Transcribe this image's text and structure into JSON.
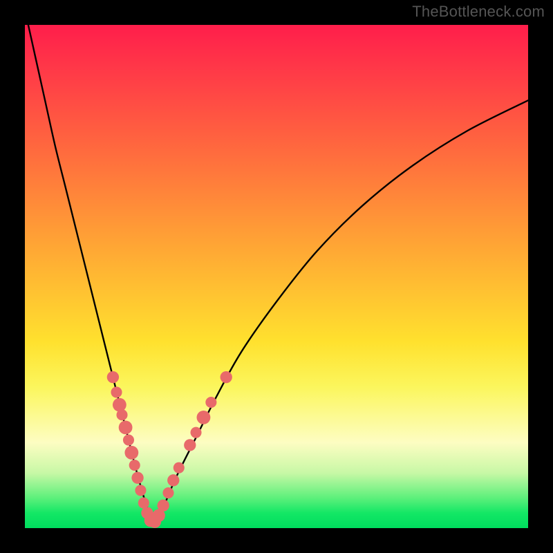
{
  "watermark": "TheBottleneck.com",
  "chart_data": {
    "type": "line",
    "title": "",
    "xlabel": "",
    "ylabel": "",
    "xlim": [
      0,
      100
    ],
    "ylim": [
      0,
      100
    ],
    "series": [
      {
        "name": "bottleneck-curve",
        "x": [
          0,
          2,
          4,
          6,
          8,
          10,
          12,
          14,
          16,
          18,
          20,
          22,
          24,
          25.5,
          27,
          30,
          34,
          38,
          43,
          50,
          58,
          67,
          77,
          88,
          100
        ],
        "values": [
          103,
          94,
          85,
          76,
          68,
          60,
          52,
          44,
          36,
          28,
          20,
          12,
          5,
          1,
          3,
          10,
          18,
          26,
          35,
          45,
          55,
          64,
          72,
          79,
          85
        ]
      }
    ],
    "markers": {
      "name": "data-points",
      "items": [
        {
          "x": 17.5,
          "y": 30.0,
          "r": 1.4
        },
        {
          "x": 18.2,
          "y": 27.0,
          "r": 1.3
        },
        {
          "x": 18.8,
          "y": 24.5,
          "r": 1.6
        },
        {
          "x": 19.3,
          "y": 22.5,
          "r": 1.3
        },
        {
          "x": 20.0,
          "y": 20.0,
          "r": 1.6
        },
        {
          "x": 20.6,
          "y": 17.5,
          "r": 1.3
        },
        {
          "x": 21.2,
          "y": 15.0,
          "r": 1.6
        },
        {
          "x": 21.8,
          "y": 12.5,
          "r": 1.3
        },
        {
          "x": 22.4,
          "y": 10.0,
          "r": 1.4
        },
        {
          "x": 23.0,
          "y": 7.5,
          "r": 1.3
        },
        {
          "x": 23.6,
          "y": 5.0,
          "r": 1.3
        },
        {
          "x": 24.3,
          "y": 3.0,
          "r": 1.4
        },
        {
          "x": 25.0,
          "y": 1.5,
          "r": 1.5
        },
        {
          "x": 25.8,
          "y": 1.3,
          "r": 1.5
        },
        {
          "x": 26.6,
          "y": 2.5,
          "r": 1.5
        },
        {
          "x": 27.5,
          "y": 4.5,
          "r": 1.4
        },
        {
          "x": 28.5,
          "y": 7.0,
          "r": 1.3
        },
        {
          "x": 29.5,
          "y": 9.5,
          "r": 1.4
        },
        {
          "x": 30.6,
          "y": 12.0,
          "r": 1.3
        },
        {
          "x": 32.8,
          "y": 16.5,
          "r": 1.4
        },
        {
          "x": 34.0,
          "y": 19.0,
          "r": 1.3
        },
        {
          "x": 35.5,
          "y": 22.0,
          "r": 1.6
        },
        {
          "x": 37.0,
          "y": 25.0,
          "r": 1.3
        },
        {
          "x": 40.0,
          "y": 30.0,
          "r": 1.4
        }
      ],
      "color": "#e86a6a"
    },
    "gradient_stops": [
      {
        "pos": 0,
        "color": "#ff1e4b"
      },
      {
        "pos": 10,
        "color": "#ff3c47"
      },
      {
        "pos": 25,
        "color": "#ff6a3e"
      },
      {
        "pos": 45,
        "color": "#ffa934"
      },
      {
        "pos": 63,
        "color": "#ffe12e"
      },
      {
        "pos": 72,
        "color": "#fbf65d"
      },
      {
        "pos": 83,
        "color": "#fdfdc2"
      },
      {
        "pos": 89,
        "color": "#c8f8a6"
      },
      {
        "pos": 94,
        "color": "#5df07b"
      },
      {
        "pos": 97,
        "color": "#13e765"
      },
      {
        "pos": 100,
        "color": "#00dd5e"
      }
    ]
  }
}
